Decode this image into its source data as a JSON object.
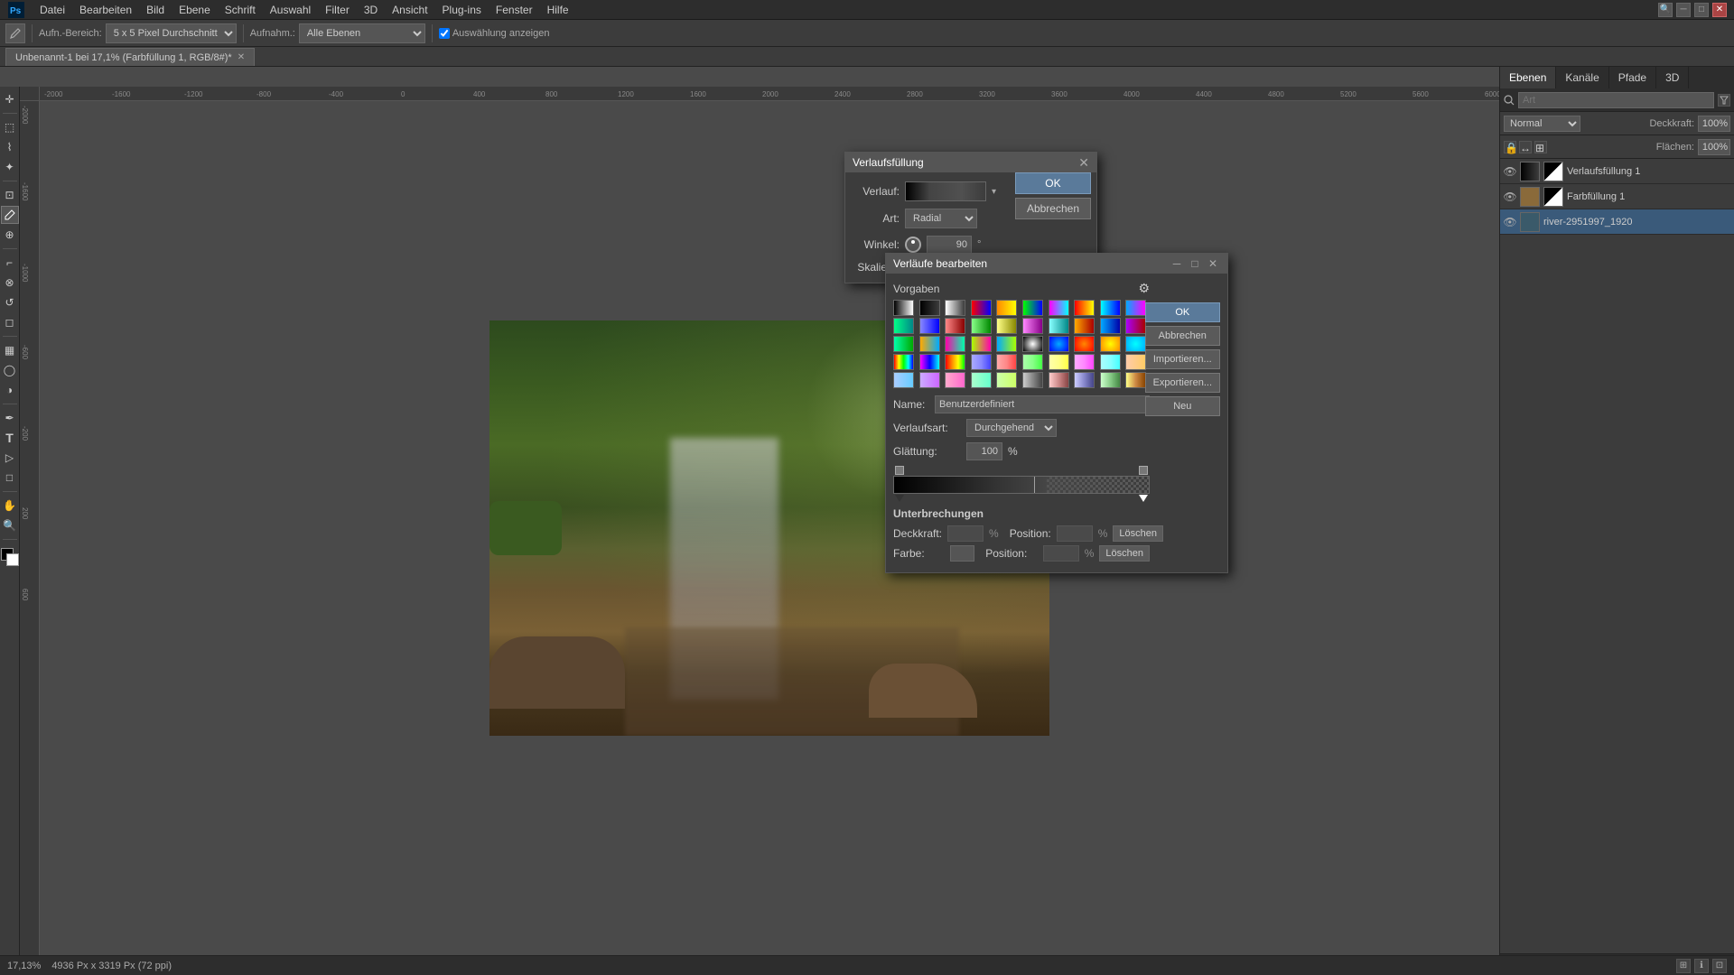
{
  "app": {
    "title": "Adobe Photoshop",
    "tab_title": "Unbenannt-1 bei 17,1% (Farbfüllung 1, RGB/8#)*",
    "zoom_level": "17,13%",
    "canvas_size": "4936 Px x 3319 Px (72 ppi)"
  },
  "menubar": {
    "items": [
      "Datei",
      "Bearbeiten",
      "Bild",
      "Ebene",
      "Schrift",
      "Auswahl",
      "Filter",
      "3D",
      "Ansicht",
      "Plug-ins",
      "Fenster",
      "Hilfe"
    ]
  },
  "toolbar": {
    "tool_label": "Aufn.-Bereich:",
    "tool_value": "5 x 5 Pixel Durchschnitt",
    "aufnahme_label": "Aufnahm.:",
    "aufnahme_value": "Alle Ebenen",
    "checkbox_label": "Auswählung anzeigen"
  },
  "panels": {
    "tabs": [
      "Ebenen",
      "Kanäle",
      "Pfade",
      "3D"
    ],
    "search_placeholder": "Art",
    "blend_mode": "Normal",
    "opacity_label": "Deckkraft:",
    "opacity_value": "100%",
    "fill_label": "Flächen:",
    "fill_value": "100%"
  },
  "layers": [
    {
      "name": "Verlaufsfüllung 1",
      "visible": true,
      "type": "gradient"
    },
    {
      "name": "Farbfüllung 1",
      "visible": true,
      "type": "color"
    },
    {
      "name": "river-2951997_1920",
      "visible": true,
      "type": "photo"
    }
  ],
  "dialog_vf": {
    "title": "Verlaufsfüllung",
    "verlauf_label": "Verlauf:",
    "art_label": "Art:",
    "art_value": "Radial",
    "winkel_label": "Winkel:",
    "winkel_value": "90",
    "skaliere_label": "Skaliere:",
    "ok_btn": "OK",
    "abbrechen_btn": "Abbrechen"
  },
  "dialog_ve": {
    "title": "Verläufe bearbeiten",
    "presets_label": "Vorgaben",
    "name_label": "Name:",
    "name_value": "Benutzerdefiniert",
    "verlaufsart_label": "Verlaufsart:",
    "verlaufsart_value": "Durchgehend",
    "glaettung_label": "Glättung:",
    "glaettung_value": "100",
    "glaettung_pct": "%",
    "unterbrechungen_title": "Unterbrechungen",
    "deckkraft_label": "Deckkraft:",
    "deckkraft_pct": "%",
    "position_label1": "Position:",
    "position_pct1": "%",
    "loeschen_btn1": "Löschen",
    "farbe_label": "Farbe:",
    "position_label2": "Position:",
    "position_pct2": "%",
    "loeschen_btn2": "Löschen",
    "ok_btn": "OK",
    "abbrechen_btn": "Abbrechen",
    "importieren_btn": "Importieren...",
    "exportieren_btn": "Exportieren...",
    "neu_btn": "Neu"
  },
  "status": {
    "zoom": "17,13%",
    "canvas_info": "4936 Px x 3319 Px (72 ppi)"
  },
  "icons": {
    "close": "✕",
    "eye": "👁",
    "gear": "⚙",
    "minimize": "─",
    "maximize": "□",
    "arrow_down": "▾",
    "settings": "⚙"
  }
}
